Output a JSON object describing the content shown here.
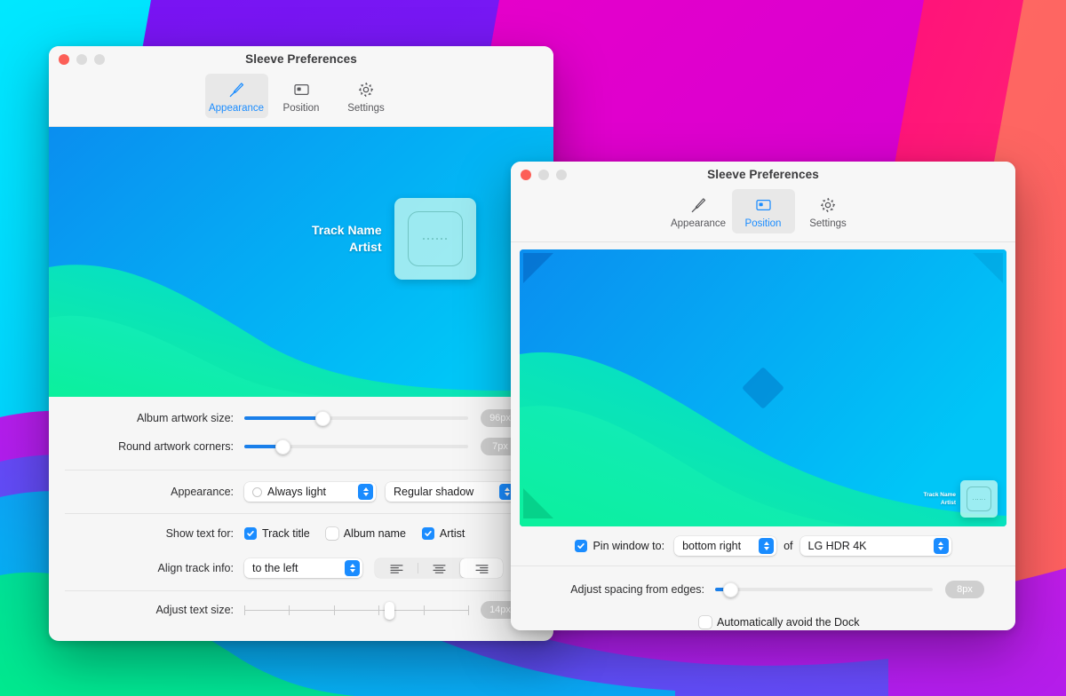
{
  "wallpaper": {
    "name": "macos-big-sur-colorful-bands",
    "colors": [
      "#00d9f5",
      "#00b6f0",
      "#7a17f0",
      "#6a2bf5",
      "#e100c8",
      "#ff0f8a",
      "#fd5f5f",
      "#00e59a",
      "#16e39a"
    ]
  },
  "window_appearance": {
    "title": "Sleeve Preferences",
    "traffic_lights": [
      "close",
      "minimize",
      "zoom"
    ],
    "tabs": [
      {
        "id": "appearance",
        "label": "Appearance",
        "icon": "paintbrush-icon",
        "active": true
      },
      {
        "id": "position",
        "label": "Position",
        "icon": "display-icon",
        "active": false
      },
      {
        "id": "settings",
        "label": "Settings",
        "icon": "gear-icon",
        "active": false
      }
    ],
    "preview": {
      "track_name": "Track Name",
      "artist": "Artist"
    },
    "rows": {
      "artwork_size": {
        "label": "Album artwork size:",
        "value": "96px",
        "fill_percent": 35
      },
      "corner_radius": {
        "label": "Round artwork corners:",
        "value": "7px",
        "fill_percent": 17
      },
      "appearance": {
        "label": "Appearance:",
        "mode_value": "Always light",
        "shadow_value": "Regular shadow"
      },
      "show_text_for": {
        "label": "Show text for:",
        "options": [
          {
            "label": "Track title",
            "checked": true
          },
          {
            "label": "Album name",
            "checked": false
          },
          {
            "label": "Artist",
            "checked": true
          }
        ]
      },
      "align_track_info": {
        "label": "Align track info:",
        "value": "to the left",
        "segments": [
          {
            "icon": "align-left-icon",
            "selected": false
          },
          {
            "icon": "align-center-icon",
            "selected": false
          },
          {
            "icon": "align-right-icon",
            "selected": true
          }
        ]
      },
      "text_size": {
        "label": "Adjust text size:",
        "value": "14px",
        "thumb_percent": 65,
        "tick_count": 6
      }
    }
  },
  "window_position": {
    "title": "Sleeve Preferences",
    "traffic_lights": [
      "close",
      "minimize",
      "zoom"
    ],
    "tabs": [
      {
        "id": "appearance",
        "label": "Appearance",
        "icon": "paintbrush-icon",
        "active": false
      },
      {
        "id": "position",
        "label": "Position",
        "icon": "display-icon",
        "active": true
      },
      {
        "id": "settings",
        "label": "Settings",
        "icon": "gear-icon",
        "active": false
      }
    ],
    "preview": {
      "track_name": "Track Name",
      "artist": "Artist",
      "corner_markers": [
        "top-left",
        "top-right",
        "bottom-left"
      ],
      "center_marker": "diamond"
    },
    "rows": {
      "pin_window": {
        "checkbox_label": "Pin window to:",
        "checked": true,
        "corner_value": "bottom right",
        "of_label": "of",
        "display_value": "LG HDR 4K"
      },
      "spacing": {
        "label": "Adjust spacing from edges:",
        "value": "8px",
        "fill_percent": 5
      },
      "avoid_dock": {
        "label": "Automatically avoid the Dock",
        "checked": false
      }
    }
  }
}
